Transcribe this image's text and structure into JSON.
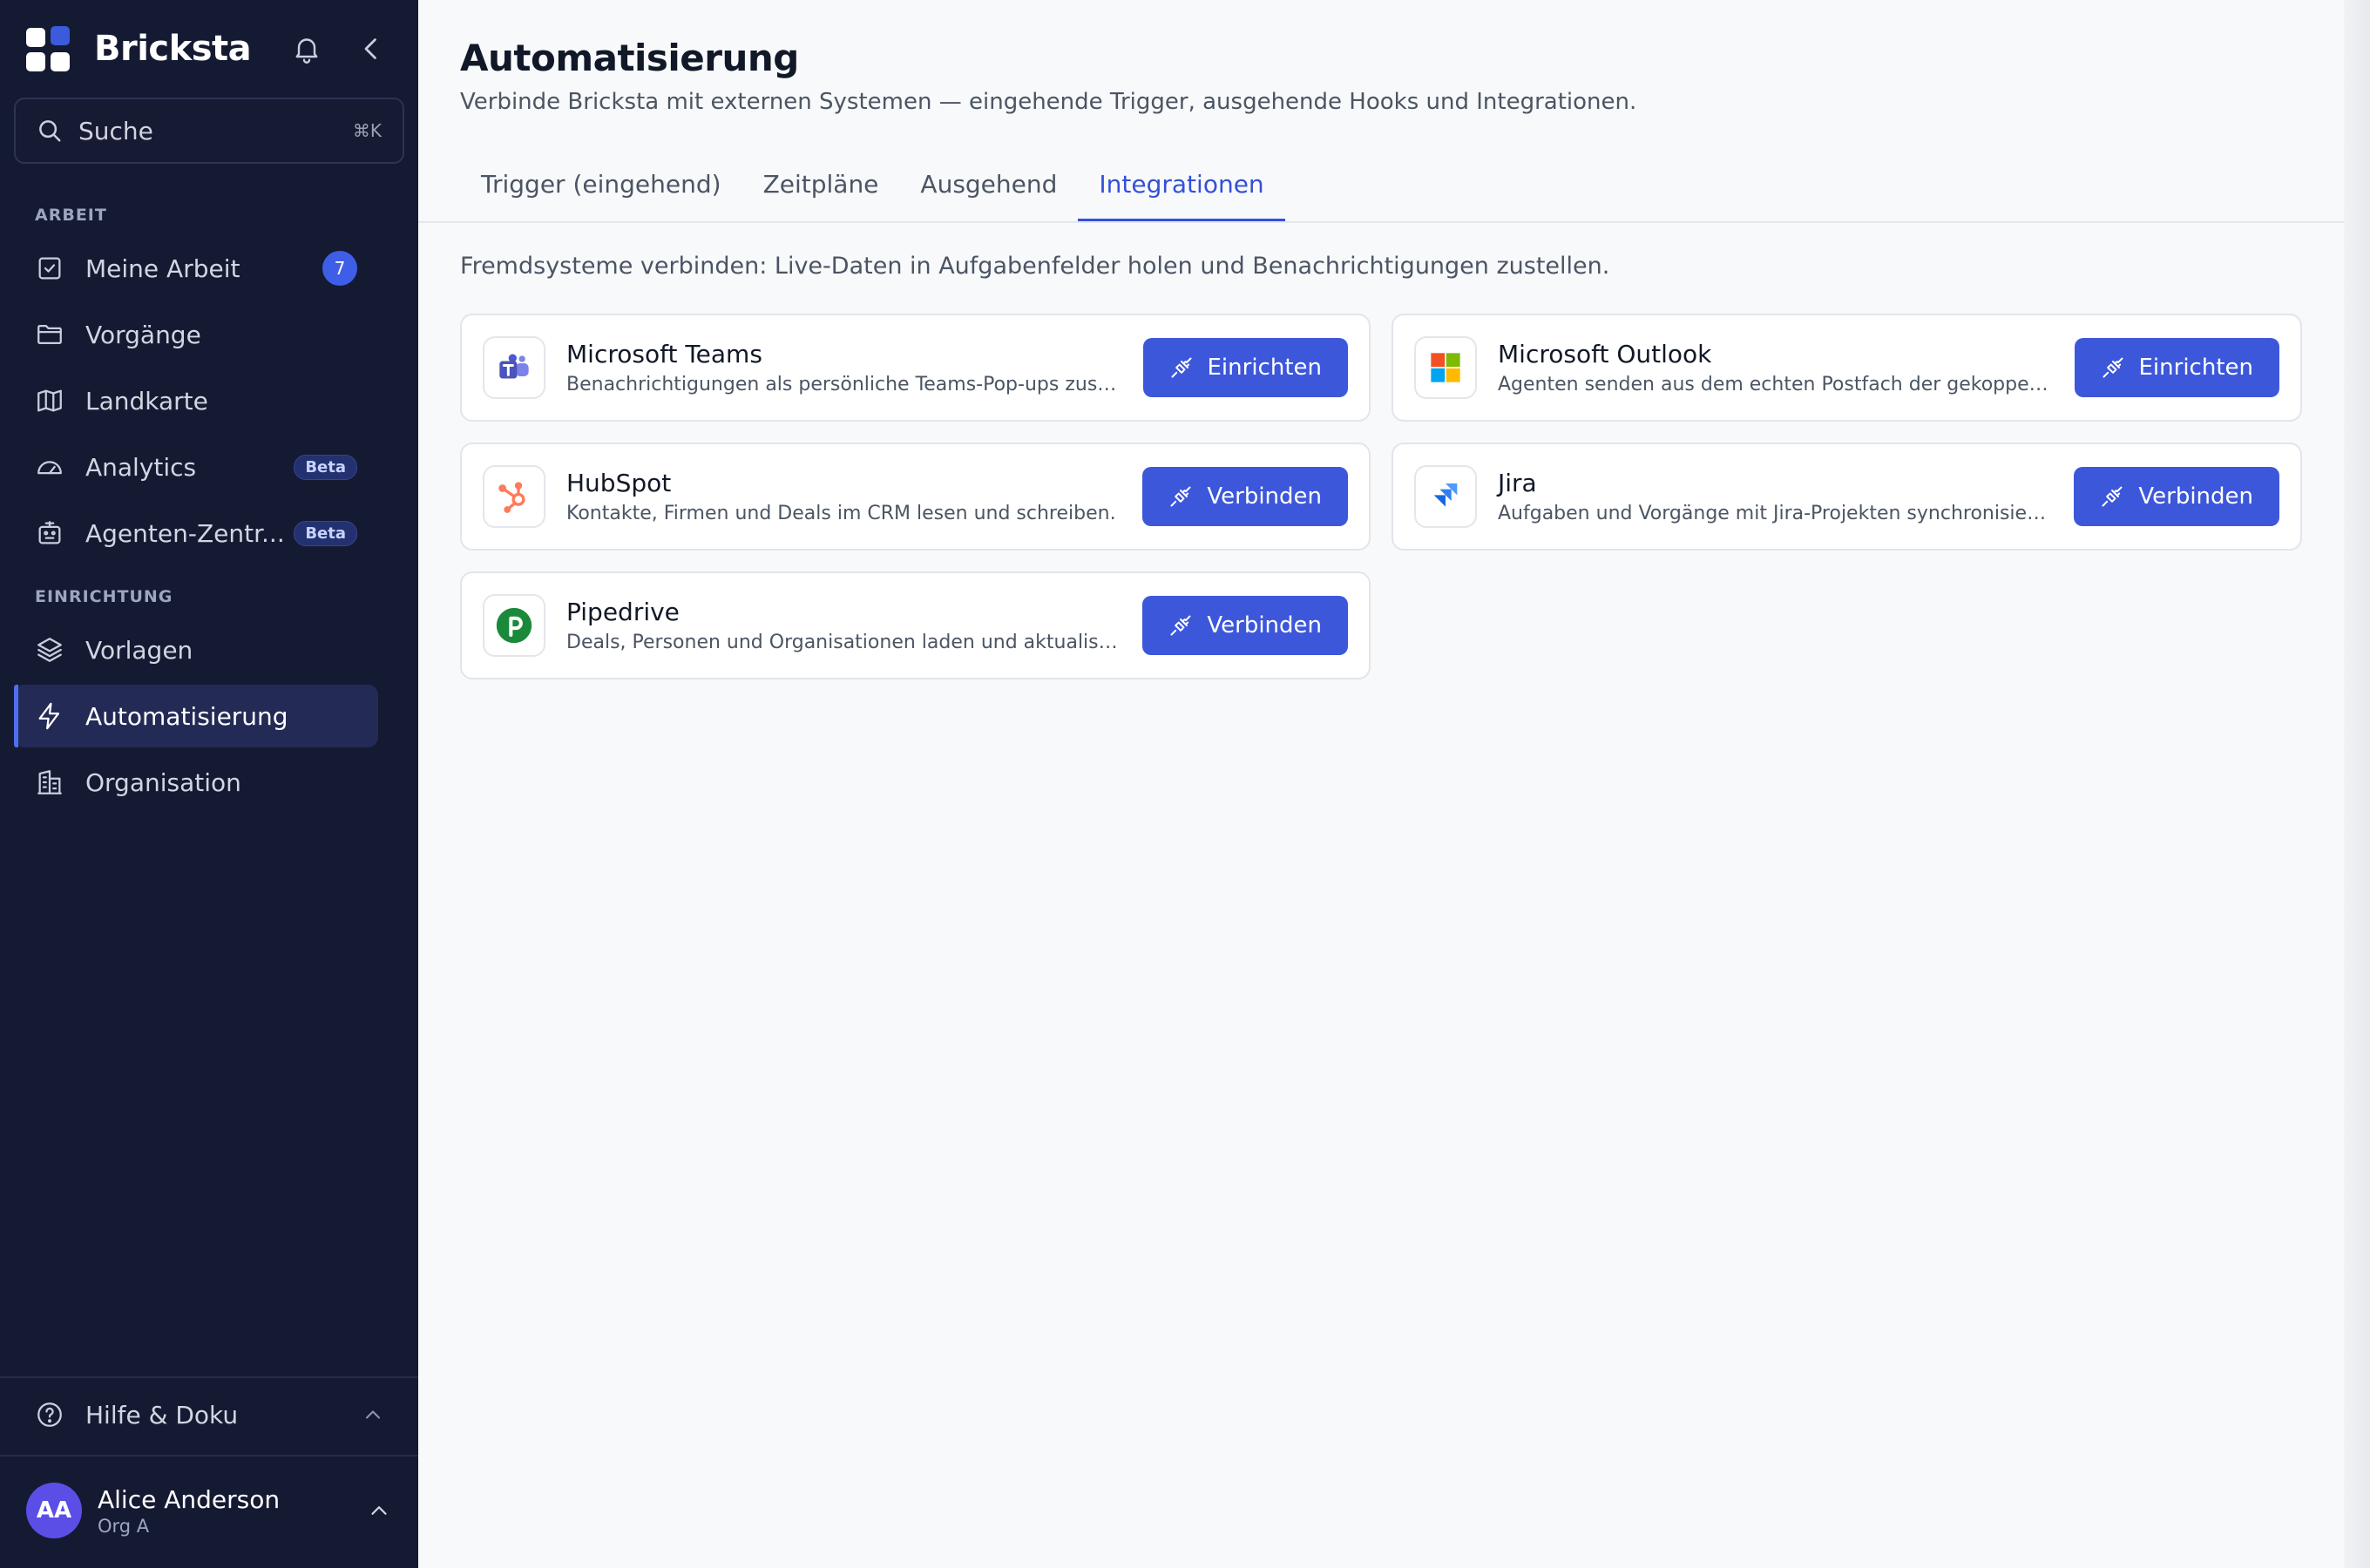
{
  "app": {
    "name": "Bricksta"
  },
  "search": {
    "label": "Suche",
    "shortcut": "⌘K"
  },
  "sidebar": {
    "sections": [
      {
        "label": "ARBEIT"
      },
      {
        "label": "EINRICHTUNG"
      }
    ],
    "items": [
      {
        "label": "Meine Arbeit",
        "badge": "7"
      },
      {
        "label": "Vorgänge"
      },
      {
        "label": "Landkarte"
      },
      {
        "label": "Analytics",
        "badge": "Beta"
      },
      {
        "label": "Agenten-Zentr...",
        "badge": "Beta"
      },
      {
        "label": "Vorlagen"
      },
      {
        "label": "Automatisierung",
        "active": true
      },
      {
        "label": "Organisation"
      }
    ],
    "help": "Hilfe & Doku",
    "user": {
      "initials": "AA",
      "name": "Alice Anderson",
      "org": "Org A"
    }
  },
  "main": {
    "title": "Automatisierung",
    "subtitle": "Verbinde Bricksta mit externen Systemen — eingehende Trigger, ausgehende Hooks und Integrationen.",
    "tabs": [
      {
        "label": "Trigger (eingehend)"
      },
      {
        "label": "Zeitpläne"
      },
      {
        "label": "Ausgehend"
      },
      {
        "label": "Integrationen",
        "active": true
      }
    ],
    "intro": "Fremdsysteme verbinden: Live-Daten in Aufgabenfelder holen und Benachrichtigungen zustellen.",
    "integrations": [
      {
        "name": "Microsoft Teams",
        "description": "Benachrichtigungen als persönliche Teams-Pop-ups zustellen.",
        "action": "Einrichten",
        "icon": "teams-icon"
      },
      {
        "name": "Microsoft Outlook",
        "description": "Agenten senden aus dem echten Postfach der gekoppelten Pe...",
        "action": "Einrichten",
        "icon": "outlook-icon"
      },
      {
        "name": "HubSpot",
        "description": "Kontakte, Firmen und Deals im CRM lesen und schreiben.",
        "action": "Verbinden",
        "icon": "hubspot-icon"
      },
      {
        "name": "Jira",
        "description": "Aufgaben und Vorgänge mit Jira-Projekten synchronisieren.",
        "action": "Verbinden",
        "icon": "jira-icon"
      },
      {
        "name": "Pipedrive",
        "description": "Deals, Personen und Organisationen laden und aktualisieren.",
        "action": "Verbinden",
        "icon": "pipedrive-icon"
      }
    ]
  },
  "colors": {
    "sidebar_bg": "#151a33",
    "accent": "#3d57db",
    "active_nav": "#222a55",
    "hubspot": "#ff7a59",
    "pipedrive": "#1a8a3a",
    "jira": "#1868db"
  }
}
